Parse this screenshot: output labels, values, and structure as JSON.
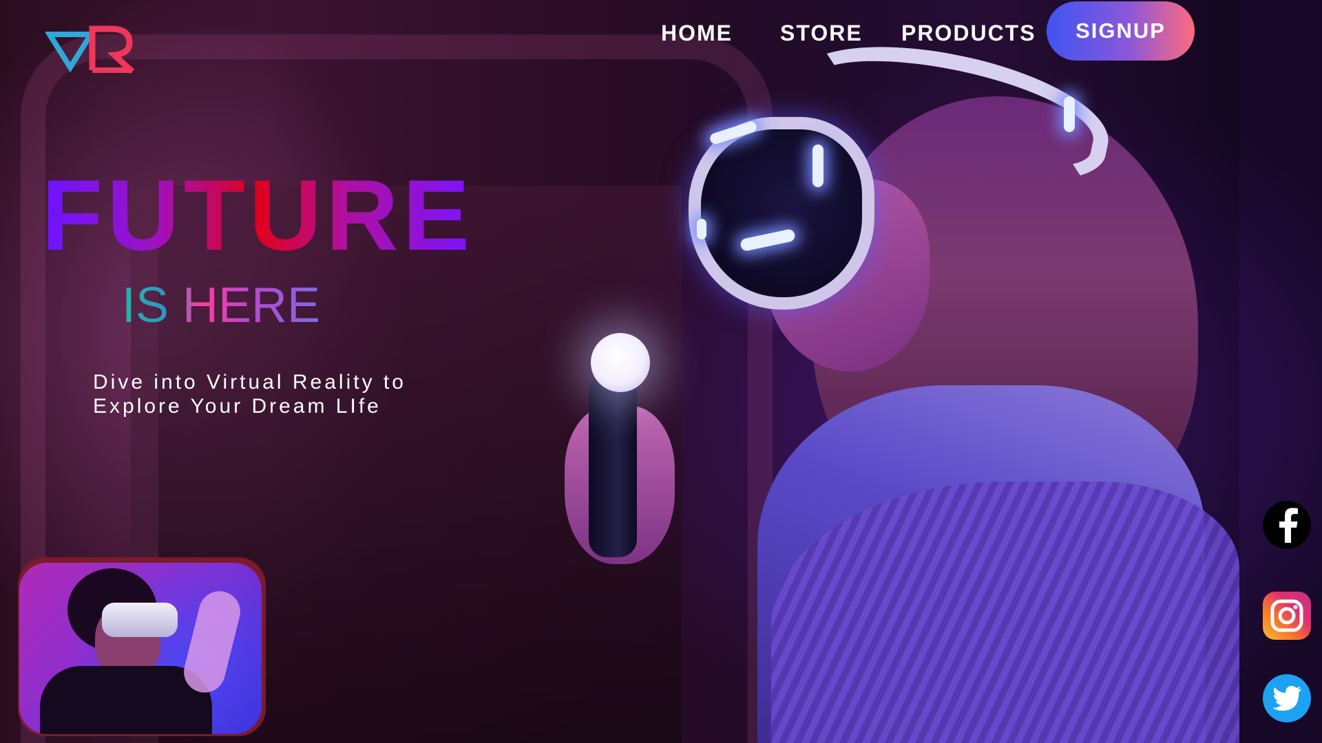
{
  "colors": {
    "signup_gradient": [
      "#3f55f2",
      "#8a57d9",
      "#ff6b7e"
    ],
    "logo_v": "#2fa7d8",
    "logo_r": "#f0365a",
    "facebook": "#000000",
    "twitter": "#1da1f2"
  },
  "header": {
    "logo_icon": "vr-logo",
    "nav": [
      {
        "label": "HOME"
      },
      {
        "label": "STORE"
      },
      {
        "label": "PRODUCTS"
      }
    ],
    "signup_label": "SIGNUP"
  },
  "hero": {
    "title": "FUTURE",
    "subtitle": "IS HERE",
    "tagline_line1": "Dive into Virtual Reality to",
    "tagline_line2": "Explore Your Dream LIfe"
  },
  "thumbnail": {
    "icon": "vr-user-thumbnail"
  },
  "social": [
    {
      "icon": "facebook-icon"
    },
    {
      "icon": "instagram-icon"
    },
    {
      "icon": "twitter-icon"
    }
  ]
}
